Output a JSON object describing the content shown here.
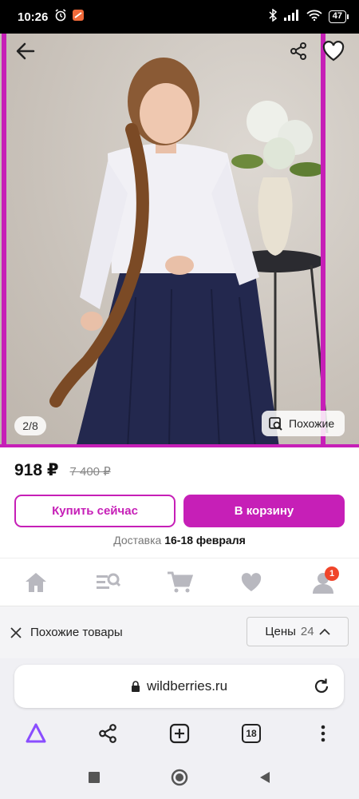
{
  "status_bar": {
    "time": "10:26",
    "battery": "47",
    "icons": [
      "alarm-icon",
      "app-notification-icon",
      "bluetooth-icon",
      "signal-icon",
      "wifi-icon",
      "battery-icon"
    ]
  },
  "gallery": {
    "counter": "2/8",
    "similar_label": "Похожие",
    "frame_color": "#c61fb7"
  },
  "product": {
    "price": "918 ₽",
    "old_price": "7 400 ₽"
  },
  "actions": {
    "buy_now": "Купить сейчас",
    "add_to_cart": "В корзину",
    "accent": "#c61fb7"
  },
  "delivery": {
    "label": "Доставка",
    "dates": "16-18 февраля"
  },
  "app_nav": {
    "items": [
      "home-icon",
      "catalog-search-icon",
      "cart-icon",
      "favorites-icon",
      "profile-icon"
    ],
    "profile_badge": "1"
  },
  "similar_bar": {
    "title": "Похожие товары",
    "prices_label": "Цены",
    "prices_count": "24"
  },
  "browser": {
    "url": "wildberries.ru",
    "tab_count": "18"
  }
}
